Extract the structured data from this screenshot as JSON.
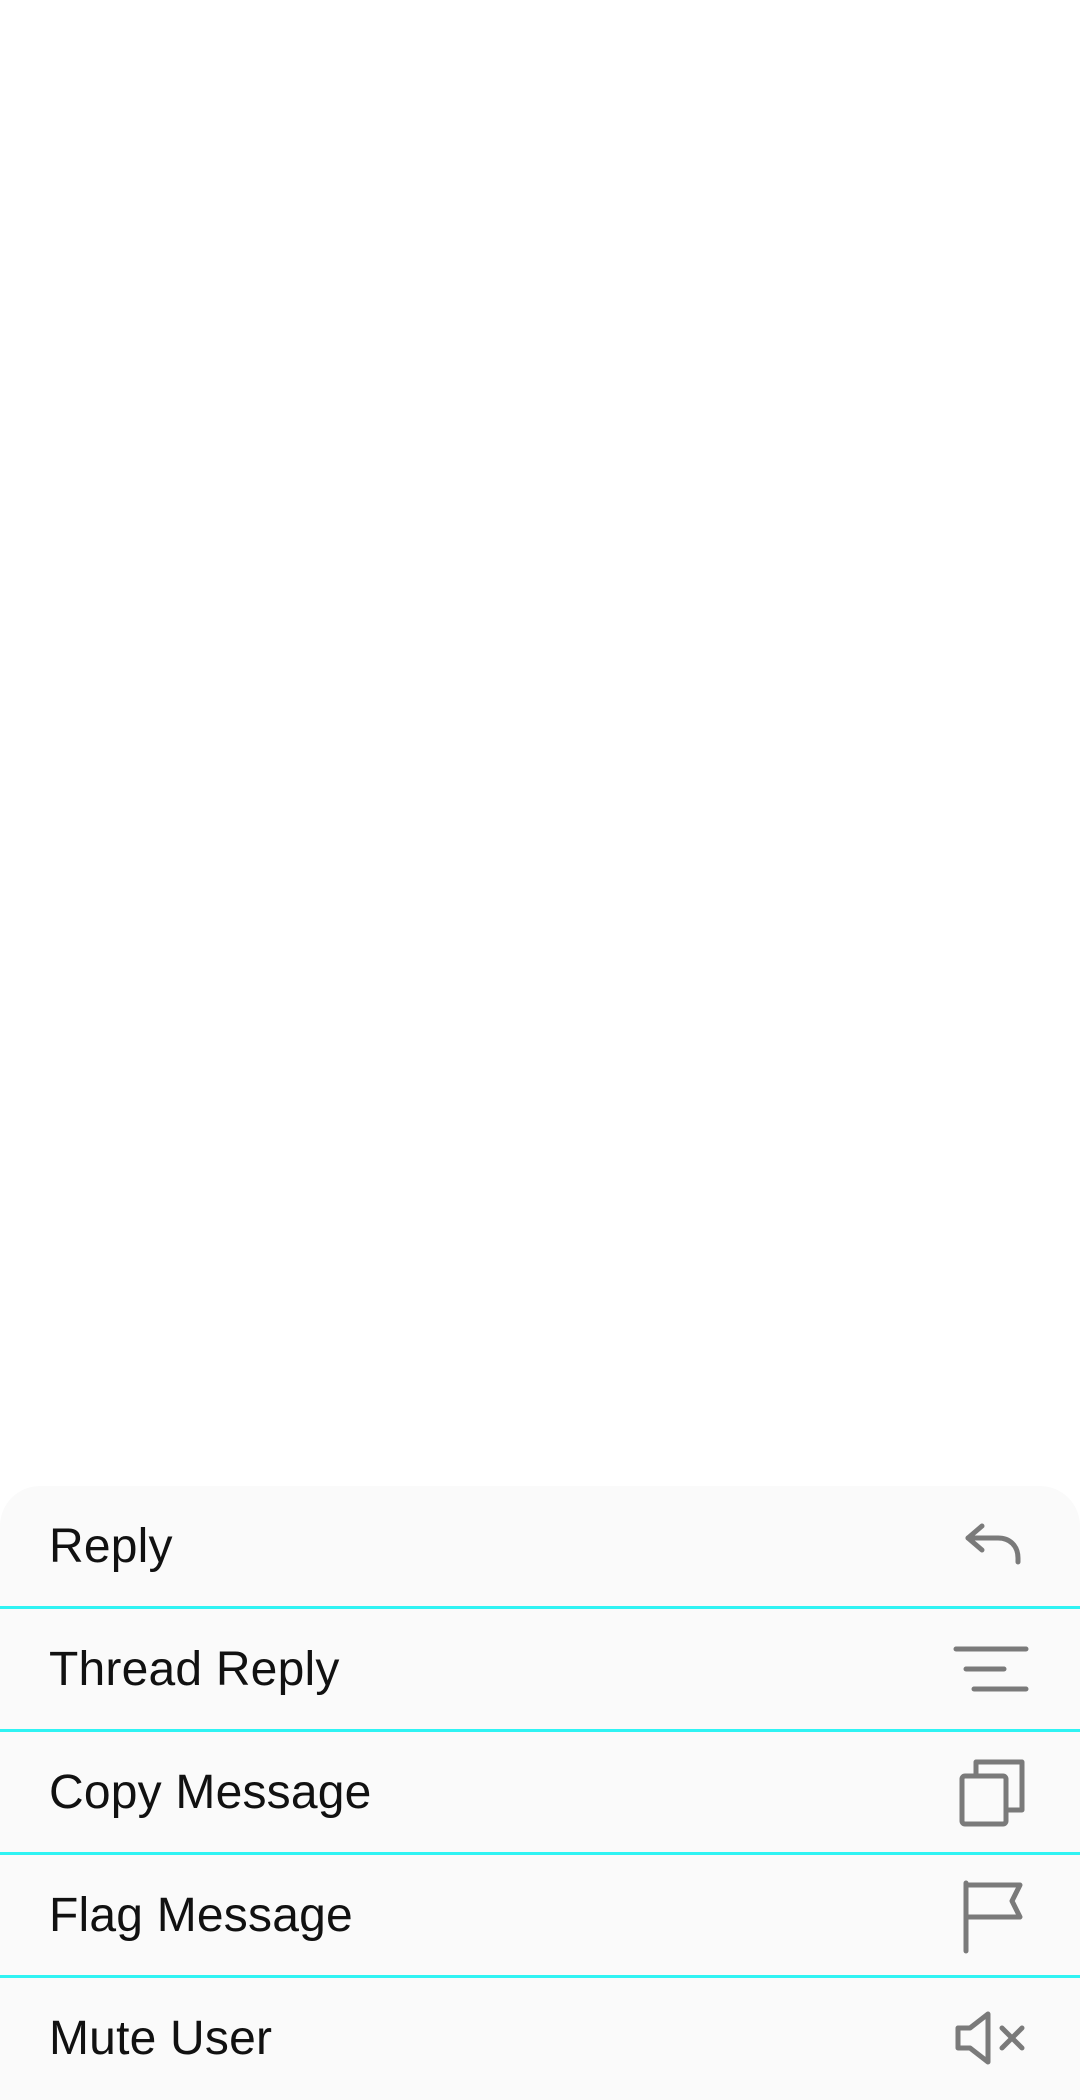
{
  "menu": {
    "items": [
      {
        "label": "Reply",
        "icon": "reply-arrow-icon"
      },
      {
        "label": "Thread Reply",
        "icon": "thread-lines-icon"
      },
      {
        "label": "Copy Message",
        "icon": "copy-icon"
      },
      {
        "label": "Flag Message",
        "icon": "flag-icon"
      },
      {
        "label": "Mute User",
        "icon": "speaker-mute-icon"
      }
    ]
  },
  "colors": {
    "divider": "#2ff3f3",
    "icon": "#7a7a7a",
    "sheet_background": "#fafafa",
    "text": "#111111"
  }
}
